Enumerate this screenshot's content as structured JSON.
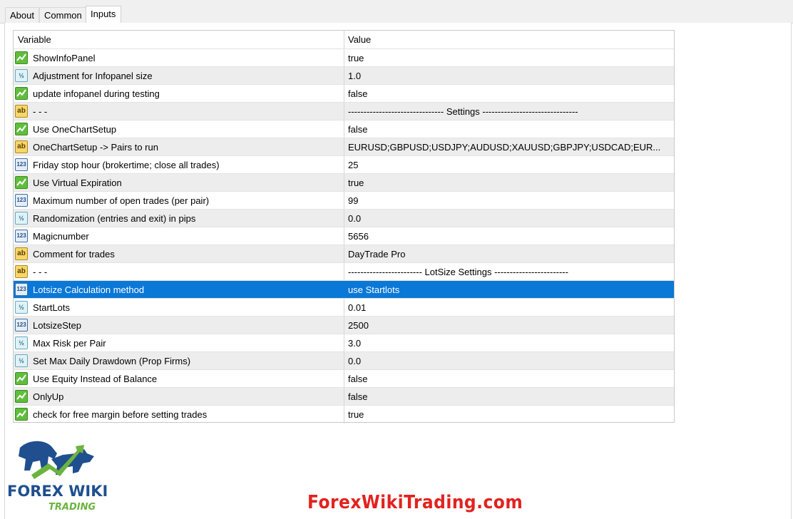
{
  "tabs": [
    {
      "label": "About",
      "active": false
    },
    {
      "label": "Common",
      "active": false
    },
    {
      "label": "Inputs",
      "active": true
    }
  ],
  "grid": {
    "headers": {
      "variable": "Variable",
      "value": "Value"
    },
    "rows": [
      {
        "type": "bool",
        "icon_text": "",
        "variable": "ShowInfoPanel",
        "value": "true"
      },
      {
        "type": "double",
        "icon_text": "½",
        "variable": "Adjustment for Infopanel size",
        "value": "1.0"
      },
      {
        "type": "bool",
        "icon_text": "",
        "variable": "update infopanel during testing",
        "value": "false"
      },
      {
        "type": "string",
        "icon_text": "ab",
        "variable": "- - -",
        "value": "------------------------------- Settings -------------------------------"
      },
      {
        "type": "bool",
        "icon_text": "",
        "variable": "Use OneChartSetup",
        "value": "false"
      },
      {
        "type": "string",
        "icon_text": "ab",
        "variable": "OneChartSetup -> Pairs to run",
        "value": "EURUSD;GBPUSD;USDJPY;AUDUSD;XAUUSD;GBPJPY;USDCAD;EUR..."
      },
      {
        "type": "int",
        "icon_text": "123",
        "variable": "Friday stop hour (brokertime; close all trades)",
        "value": "25"
      },
      {
        "type": "bool",
        "icon_text": "",
        "variable": "Use Virtual Expiration",
        "value": "true"
      },
      {
        "type": "int",
        "icon_text": "123",
        "variable": "Maximum number of open trades (per pair)",
        "value": "99"
      },
      {
        "type": "double",
        "icon_text": "½",
        "variable": "Randomization (entries and exit) in pips",
        "value": "0.0"
      },
      {
        "type": "int",
        "icon_text": "123",
        "variable": "Magicnumber",
        "value": "5656"
      },
      {
        "type": "string",
        "icon_text": "ab",
        "variable": "Comment for trades",
        "value": "DayTrade Pro"
      },
      {
        "type": "string",
        "icon_text": "ab",
        "variable": "- - -",
        "value": "------------------------ LotSize Settings ------------------------"
      },
      {
        "type": "int",
        "icon_text": "123",
        "variable": "Lotsize Calculation method",
        "value": "use Startlots",
        "selected": true
      },
      {
        "type": "double",
        "icon_text": "½",
        "variable": "StartLots",
        "value": "0.01"
      },
      {
        "type": "int",
        "icon_text": "123",
        "variable": "LotsizeStep",
        "value": "2500"
      },
      {
        "type": "double",
        "icon_text": "½",
        "variable": "Max Risk per Pair",
        "value": "3.0"
      },
      {
        "type": "double",
        "icon_text": "½",
        "variable": "Set Max Daily Drawdown (Prop Firms)",
        "value": "0.0"
      },
      {
        "type": "bool",
        "icon_text": "",
        "variable": "Use Equity Instead of Balance",
        "value": "false"
      },
      {
        "type": "bool",
        "icon_text": "",
        "variable": "OnlyUp",
        "value": "false"
      },
      {
        "type": "bool",
        "icon_text": "",
        "variable": "check for free margin before setting trades",
        "value": "true"
      }
    ]
  },
  "logo": {
    "line1": "FOREX WIKI",
    "line2": "TRADING"
  },
  "watermark": "ForexWikiTrading.com",
  "colors": {
    "selection": "#0a78d7",
    "watermark": "#e2221f",
    "logo_blue": "#1f4f8f",
    "logo_green": "#6cb33f"
  }
}
